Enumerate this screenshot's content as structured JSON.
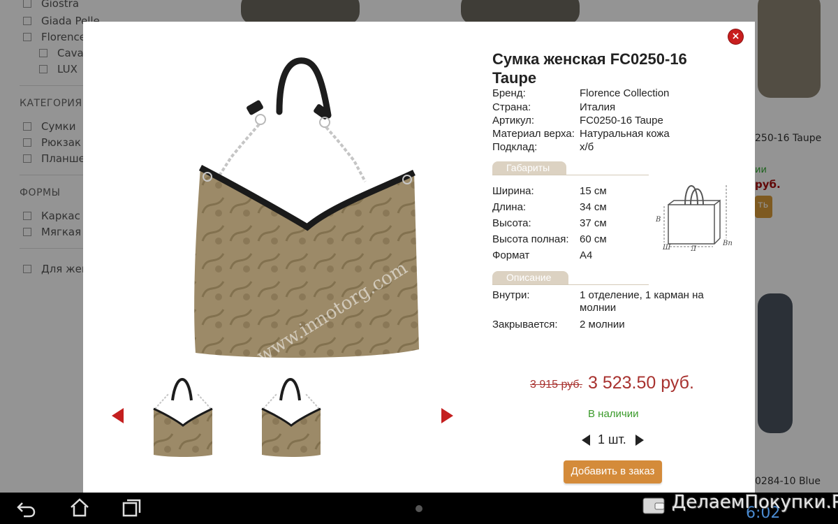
{
  "background_page": {
    "filters_top": [
      "Giostra",
      "Giada Pelle",
      "Florence"
    ],
    "filters_sub": [
      "Cava",
      "LUX"
    ],
    "category_heading": "КАТЕГОРИЯ",
    "category_items": [
      "Сумки",
      "Рюкзак",
      "Планше"
    ],
    "forms_heading": "ФОРМЫ",
    "forms_items": [
      "Каркас",
      "Мягкая"
    ],
    "extra_item": "Для жен",
    "card_label_1": "250-16 Taupe",
    "card_price_1": "руб.",
    "card_stock_1": "ии",
    "card_button_1": "ть",
    "card_label_2": "0284-10 Blue"
  },
  "modal": {
    "close_icon": "close-icon",
    "title": "Сумка женская FC0250-16 Taupe",
    "main_image_watermark": "www.innotorg.com",
    "specs": [
      {
        "label": "Бренд:",
        "value": "Florence Collection"
      },
      {
        "label": "Страна:",
        "value": "Италия"
      },
      {
        "label": "Артикул:",
        "value": "FC0250-16 Taupe"
      },
      {
        "label": "Материал верха:",
        "value": "Натуральная кожа"
      },
      {
        "label": "Подклад:",
        "value": "х/б"
      }
    ],
    "dimensions_tab": "Габариты",
    "dimensions": [
      {
        "label": "Ширина:",
        "value": "15 см"
      },
      {
        "label": "Длина:",
        "value": "34 см"
      },
      {
        "label": "Высота:",
        "value": "37 см"
      },
      {
        "label": "Высота полная:",
        "value": "60 см"
      },
      {
        "label": "Формат",
        "value": "А4"
      }
    ],
    "diagram_labels": {
      "w": "Ш",
      "l": "Д",
      "h": "В",
      "hp": "Вп"
    },
    "description_tab": "Описание",
    "description": [
      {
        "label": "Внутри:",
        "value": "1 отделение, 1 карман на молнии"
      },
      {
        "label": "Закрывается:",
        "value": "2 молнии"
      }
    ],
    "old_price": "3 915 руб.",
    "new_price": "3 523.50 руб.",
    "stock_status": "В наличии",
    "quantity": "1 шт.",
    "add_button": "Добавить в заказ"
  },
  "colors": {
    "accent_red": "#c41f1f",
    "price_red": "#a8322f",
    "stock_green": "#3a9a2a",
    "button_orange": "#d48b3a",
    "tab_beige": "#dcd2c2"
  },
  "navbar": {
    "icons": [
      "back-icon",
      "home-icon",
      "recent-apps-icon"
    ],
    "watermark": "ДелаемПокупки.Ру",
    "clock_fragment": "6:02"
  }
}
